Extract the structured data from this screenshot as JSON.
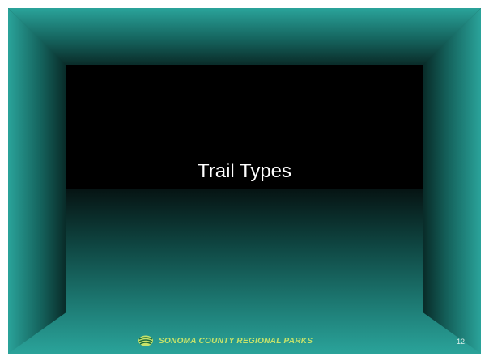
{
  "slide": {
    "title": "Trail Types",
    "footer_logo_text": "SONOMA COUNTY REGIONAL PARKS",
    "page_number": "12",
    "colors": {
      "teal": "#2aa39a",
      "back_wall": "#000000",
      "logo_text": "#c7e36a"
    },
    "logo_icon": "sonoma-parks-leaf-icon"
  }
}
